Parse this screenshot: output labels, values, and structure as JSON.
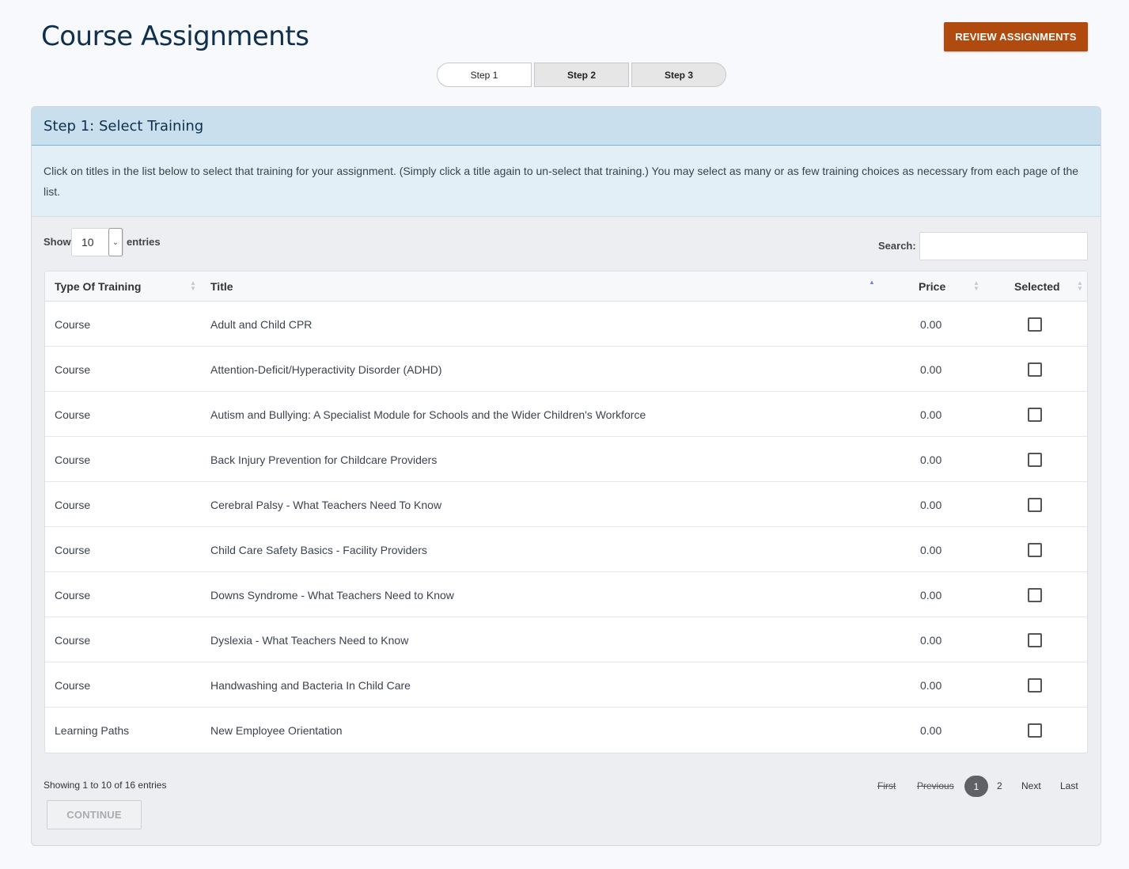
{
  "page": {
    "title": "Course Assignments"
  },
  "header": {
    "review_label": "REVIEW ASSIGNMENTS"
  },
  "steps": [
    "Step 1",
    "Step 2",
    "Step 3"
  ],
  "panel": {
    "heading": "Step 1: Select Training",
    "intro": "Click on titles in the list below to select that training for your assignment. (Simply click a title again to un-select that training.) You may select as many or as few training choices as necessary from each page of the list."
  },
  "controls": {
    "show_label": "Show",
    "entries_value": "10",
    "entries_label": "entries",
    "search_label": "Search:",
    "search_value": ""
  },
  "table": {
    "columns": [
      "Type Of Training",
      "Title",
      "Price",
      "Selected"
    ],
    "sorted_column": "Title",
    "rows": [
      {
        "type": "Course",
        "title": "Adult and Child CPR",
        "price": "0.00",
        "selected": false
      },
      {
        "type": "Course",
        "title": "Attention-Deficit/Hyperactivity Disorder (ADHD)",
        "price": "0.00",
        "selected": false
      },
      {
        "type": "Course",
        "title": "Autism and Bullying: A Specialist Module for Schools and the Wider Children's Workforce",
        "price": "0.00",
        "selected": false
      },
      {
        "type": "Course",
        "title": "Back Injury Prevention for Childcare Providers",
        "price": "0.00",
        "selected": false
      },
      {
        "type": "Course",
        "title": "Cerebral Palsy - What Teachers Need To Know",
        "price": "0.00",
        "selected": false
      },
      {
        "type": "Course",
        "title": "Child Care Safety Basics - Facility Providers",
        "price": "0.00",
        "selected": false
      },
      {
        "type": "Course",
        "title": "Downs Syndrome - What Teachers Need to Know",
        "price": "0.00",
        "selected": false
      },
      {
        "type": "Course",
        "title": "Dyslexia - What Teachers Need to Know",
        "price": "0.00",
        "selected": false
      },
      {
        "type": "Course",
        "title": "Handwashing and Bacteria In Child Care",
        "price": "0.00",
        "selected": false
      },
      {
        "type": "Learning Paths",
        "title": "New Employee Orientation",
        "price": "0.00",
        "selected": false
      }
    ]
  },
  "footer": {
    "showing": "Showing 1 to 10 of 16 entries",
    "pager": {
      "first": "First",
      "previous": "Previous",
      "current": "1",
      "page2": "2",
      "next": "Next",
      "last": "Last"
    },
    "continue_label": "CONTINUE"
  },
  "colors": {
    "brand": "#0f2f4e",
    "accent": "#b04a0e",
    "header_band": "#c9dfee"
  }
}
